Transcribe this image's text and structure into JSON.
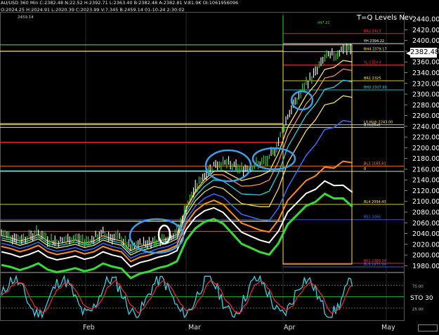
{
  "header": {
    "symbol_line": "AU/USD 360 Min  C:2382.48  N:22.52  H:2392.71  L:2363.40  B:2382.48  A:2382.81  V:81.9K  OI:1061956096",
    "sub_line": "O:2024.25  H:2024.91  L:2020.39  C:2023.99  V:7.345  B:2459.14  01-10-24  2:30:02",
    "hi_label": "2459.14"
  },
  "title": "T=Q Levels Nev",
  "last_price": "2382.48",
  "oscillator": {
    "label": "STO  30",
    "levels": [
      "75.00",
      "25.00"
    ]
  },
  "colors": {
    "price_axis_text": "#ffffff",
    "bar_up": "#f0f0f0",
    "bar_green": "#2ecc2e",
    "ma_fast": "#ffe64a",
    "ma_orange": "#ff8c1a",
    "ma_blue": "#3a6bff",
    "ma_white": "#ffffff",
    "ma_green": "#33dd33",
    "ma_cyan": "#22d4e0",
    "circle": "#3a9fe8",
    "stoch_k": "#33d4e8",
    "stoch_d": "#ff2a2a"
  },
  "chart_data": {
    "type": "line",
    "title": "T=Q Levels Nev",
    "x_tick_labels": [
      "Feb",
      "Mar",
      "Apr",
      "May"
    ],
    "y_ticks": [
      "2440.00",
      "2420.00",
      "2400.00",
      "2380.00",
      "2360.00",
      "2340.00",
      "2320.00",
      "2300.00",
      "2280.00",
      "2260.00",
      "2240.00",
      "2220.00",
      "2200.00",
      "2180.00",
      "2160.00",
      "2140.00",
      "2120.00",
      "2100.00",
      "2080.00",
      "2060.00",
      "2040.00",
      "2020.00",
      "2000.00",
      "1980.00"
    ],
    "ylim": [
      1970,
      2452
    ],
    "price_series": [
      {
        "i": 0,
        "v": 2040
      },
      {
        "i": 5,
        "v": 2036
      },
      {
        "i": 10,
        "v": 2030
      },
      {
        "i": 15,
        "v": 2035
      },
      {
        "i": 20,
        "v": 2042
      },
      {
        "i": 25,
        "v": 2030
      },
      {
        "i": 30,
        "v": 2025
      },
      {
        "i": 35,
        "v": 2028
      },
      {
        "i": 40,
        "v": 2032
      },
      {
        "i": 45,
        "v": 2026
      },
      {
        "i": 50,
        "v": 2030
      },
      {
        "i": 55,
        "v": 2040
      },
      {
        "i": 60,
        "v": 2034
      },
      {
        "i": 65,
        "v": 2030
      },
      {
        "i": 70,
        "v": 2012
      },
      {
        "i": 75,
        "v": 2020
      },
      {
        "i": 80,
        "v": 2024
      },
      {
        "i": 85,
        "v": 2030
      },
      {
        "i": 90,
        "v": 2034
      },
      {
        "i": 95,
        "v": 2042
      },
      {
        "i": 100,
        "v": 2090
      },
      {
        "i": 105,
        "v": 2125
      },
      {
        "i": 110,
        "v": 2150
      },
      {
        "i": 115,
        "v": 2168
      },
      {
        "i": 120,
        "v": 2172
      },
      {
        "i": 125,
        "v": 2166
      },
      {
        "i": 130,
        "v": 2160
      },
      {
        "i": 135,
        "v": 2165
      },
      {
        "i": 140,
        "v": 2170
      },
      {
        "i": 145,
        "v": 2178
      },
      {
        "i": 150,
        "v": 2212
      },
      {
        "i": 155,
        "v": 2260
      },
      {
        "i": 160,
        "v": 2290
      },
      {
        "i": 165,
        "v": 2320
      },
      {
        "i": 170,
        "v": 2340
      },
      {
        "i": 175,
        "v": 2368
      },
      {
        "i": 180,
        "v": 2372
      },
      {
        "i": 185,
        "v": 2385
      },
      {
        "i": 190,
        "v": 2382
      }
    ],
    "horizontal_levels": [
      {
        "label": "YH 2394.22",
        "value": 2394.22,
        "color": "#ffffff"
      },
      {
        "label": "BH4 2379.17",
        "value": 2379.17,
        "color": "#ffe64a"
      },
      {
        "label": "BR2 2413",
        "value": 2413,
        "color": "#ff3030"
      },
      {
        "label": "YL 2354.4",
        "value": 2354.4,
        "color": "#ff3030"
      },
      {
        "label": "BR1 2325",
        "value": 2325,
        "color": "#ffe64a"
      },
      {
        "label": "BH3 2307.99",
        "value": 2307.99,
        "color": "#22d4e0"
      },
      {
        "label": "L0 High 2243.00",
        "value": 2243,
        "color": "#ffe64a"
      },
      {
        "label": "B Rs10ve",
        "value": 2238,
        "color": "#ffffff"
      },
      {
        "label": "BL3 2165.61",
        "value": 2165.61,
        "color": "#ff8c1a"
      },
      {
        "label": "0",
        "value": 2156,
        "color": "#ffffff"
      },
      {
        "label": "BL4 2094.43",
        "value": 2094.43,
        "color": "#ffe64a"
      },
      {
        "label": "BS1 2066",
        "value": 2066,
        "color": "#3a6bff"
      },
      {
        "label": "BS1 1984.34",
        "value": 1984.34,
        "color": "#ff3030"
      },
      {
        "label": "BLS 1977.94",
        "value": 1977.94,
        "color": "#3a6bff"
      }
    ],
    "annotations": [
      "447.21"
    ],
    "legend": "none"
  }
}
